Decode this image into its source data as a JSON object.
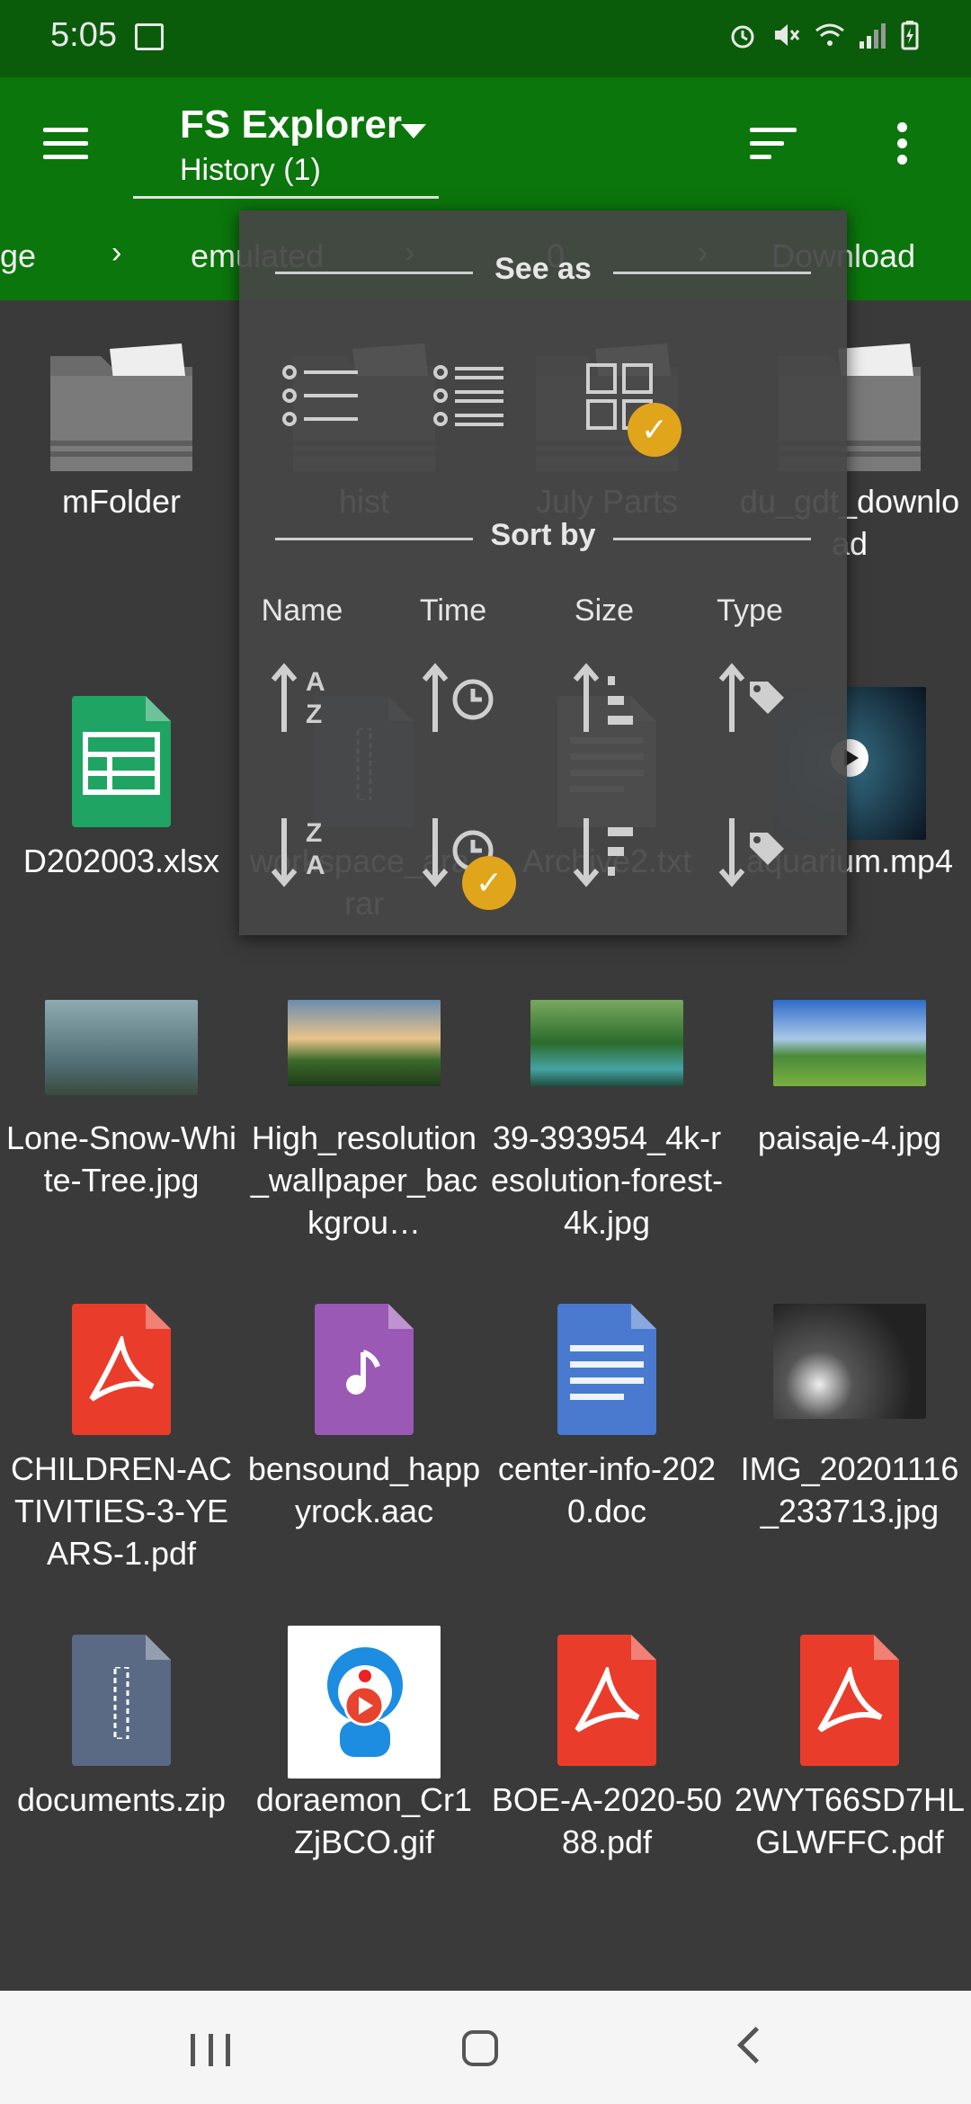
{
  "status": {
    "time": "5:05"
  },
  "appbar": {
    "title": "FS Explorer",
    "subtitle": "History (1)"
  },
  "breadcrumb": [
    "ge",
    "emulated",
    "0",
    "Download"
  ],
  "files": [
    {
      "name": "mFolder",
      "kind": "folder"
    },
    {
      "name": "hist",
      "kind": "folder"
    },
    {
      "name": "July Parts",
      "kind": "folder"
    },
    {
      "name": "du_gdt_download",
      "kind": "folder"
    },
    {
      "name": "D202003.xlsx",
      "kind": "xlsx",
      "color": "#1fa463"
    },
    {
      "name": "workspace_ara.rar",
      "kind": "zip",
      "color": "#5a6a85"
    },
    {
      "name": "Archive2.txt",
      "kind": "txt",
      "color": "#9e9e9e"
    },
    {
      "name": "aquarium.mp4",
      "kind": "video"
    },
    {
      "name": "Lone-Snow-White-Tree.jpg",
      "kind": "photo-tree"
    },
    {
      "name": "High_resolution_wallpaper_backgrou…",
      "kind": "photo-river"
    },
    {
      "name": "39-393954_4k-resolution-forest-4k.jpg",
      "kind": "photo-forest"
    },
    {
      "name": "paisaje-4.jpg",
      "kind": "photo-mountain"
    },
    {
      "name": "CHILDREN-ACTIVITIES-3-YEARS-1.pdf",
      "kind": "pdf",
      "color": "#ea3c2b"
    },
    {
      "name": "bensound_happyrock.aac",
      "kind": "audio",
      "color": "#9b59b6"
    },
    {
      "name": "center-info-2020.doc",
      "kind": "doc",
      "color": "#4a7ad0"
    },
    {
      "name": "IMG_20201116_233713.jpg",
      "kind": "photo-dark"
    },
    {
      "name": "documents.zip",
      "kind": "zip",
      "color": "#5a6a85"
    },
    {
      "name": "doraemon_Cr1ZjBCO.gif",
      "kind": "gif"
    },
    {
      "name": "BOE-A-2020-5088.pdf",
      "kind": "pdf",
      "color": "#ea3c2b"
    },
    {
      "name": "2WYT66SD7HLGLWFFC.pdf",
      "kind": "pdf",
      "color": "#ea3c2b"
    }
  ],
  "popup": {
    "see_as": "See as",
    "sort_by": "Sort by",
    "view_selected": "grid",
    "sort_columns": [
      "Name",
      "Time",
      "Size",
      "Type"
    ],
    "sort_selected": "time-descending",
    "check_glyph": "✓",
    "accent": "#e0a51a"
  },
  "colors": {
    "appbar": "#0b760b",
    "statusbar": "#0a5c0a",
    "background": "#3a3a3a"
  }
}
